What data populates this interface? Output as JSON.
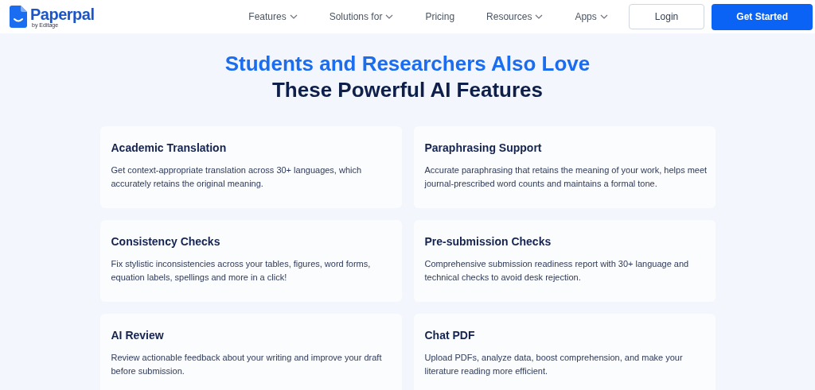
{
  "header": {
    "logo": {
      "name": "Paperpal",
      "byline": "by Editage"
    },
    "nav": [
      {
        "label": "Features",
        "dropdown": true
      },
      {
        "label": "Solutions for",
        "dropdown": true
      },
      {
        "label": "Pricing",
        "dropdown": false
      },
      {
        "label": "Resources",
        "dropdown": true
      },
      {
        "label": "Apps",
        "dropdown": true
      }
    ],
    "login": "Login",
    "cta": "Get Started"
  },
  "hero": {
    "title_line_1": "Students and Researchers Also Love",
    "title_line_2": "These Powerful AI Features"
  },
  "features": [
    {
      "title": "Academic Translation",
      "text": "Get context-appropriate translation across 30+ languages, which accurately retains the original meaning."
    },
    {
      "title": "Paraphrasing Support",
      "text": "Accurate paraphrasing that retains the meaning of your work, helps meet journal-prescribed word counts and maintains a formal tone."
    },
    {
      "title": "Consistency Checks",
      "text": "Fix stylistic inconsistencies across your tables, figures, word forms, equation labels, spellings and more in a click!"
    },
    {
      "title": "Pre-submission Checks",
      "text": "Comprehensive submission readiness report with 30+ language and technical checks to avoid desk rejection."
    },
    {
      "title": "AI Review",
      "text": "Review actionable feedback about your writing and improve your draft before submission."
    },
    {
      "title": "Chat PDF",
      "text": "Upload PDFs, analyze data, boost comprehension, and make your literature reading more efficient."
    }
  ]
}
